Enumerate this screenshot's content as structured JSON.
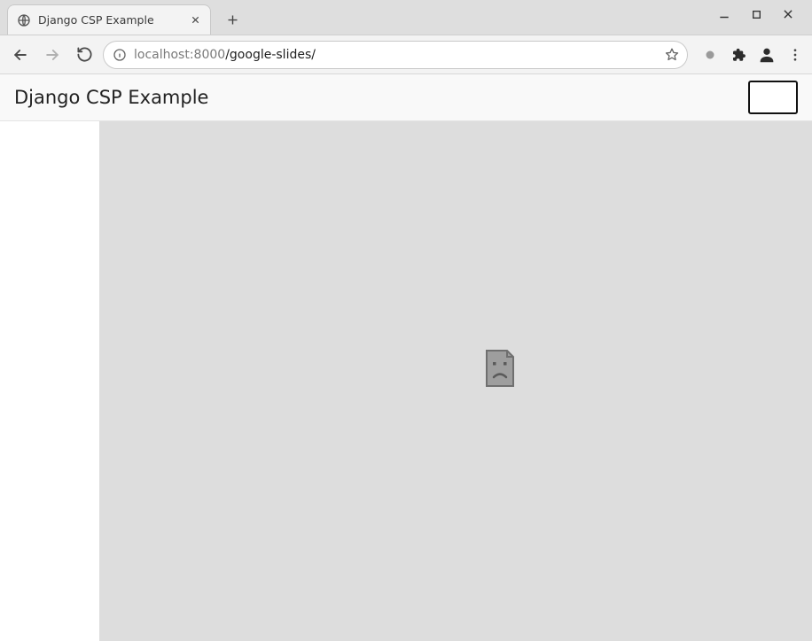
{
  "tab": {
    "title": "Django CSP Example"
  },
  "url": {
    "host_sub": "localhost",
    "port": ":8000",
    "path": "/google-slides/"
  },
  "page": {
    "heading": "Django CSP Example"
  }
}
